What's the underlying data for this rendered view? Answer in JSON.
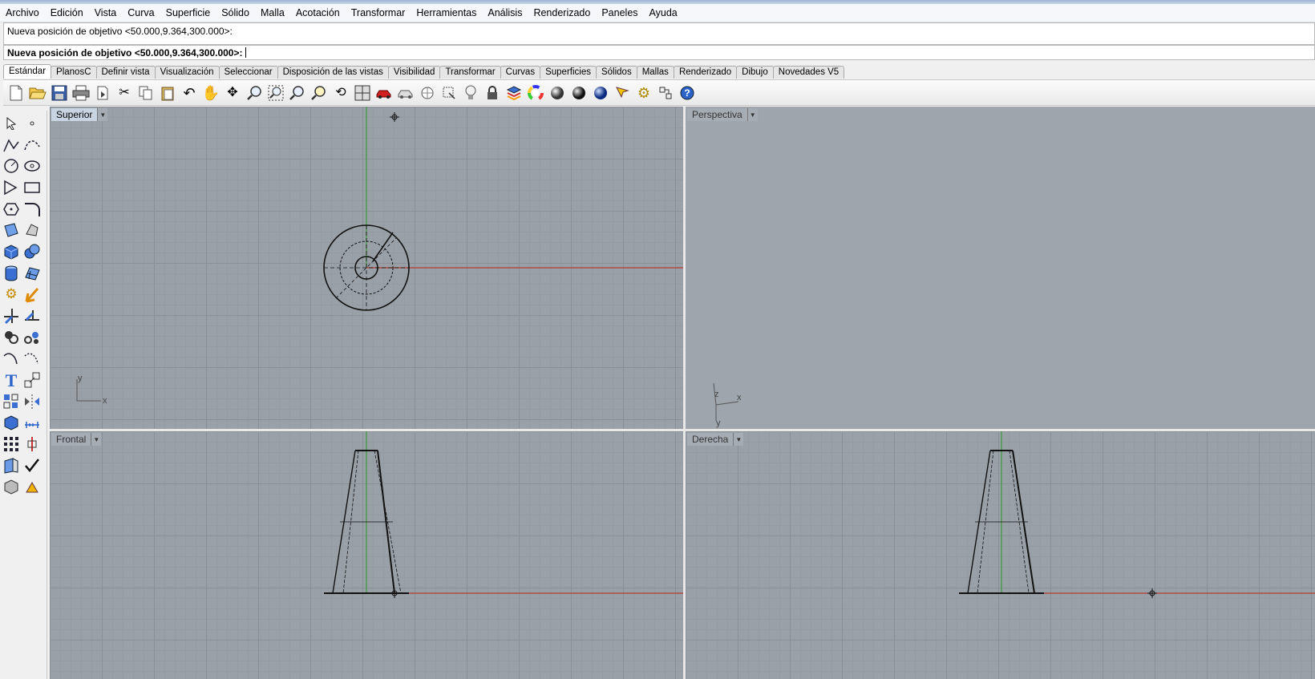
{
  "menu": [
    "Archivo",
    "Edición",
    "Vista",
    "Curva",
    "Superficie",
    "Sólido",
    "Malla",
    "Acotación",
    "Transformar",
    "Herramientas",
    "Análisis",
    "Renderizado",
    "Paneles",
    "Ayuda"
  ],
  "command": {
    "history": "Nueva posición de objetivo <50.000,9.364,300.000>:",
    "prompt": "Nueva posición de objetivo <50.000,9.364,300.000>:",
    "value": ""
  },
  "tabs": [
    "Estándar",
    "PlanosC",
    "Definir vista",
    "Visualización",
    "Seleccionar",
    "Disposición de las vistas",
    "Visibilidad",
    "Transformar",
    "Curvas",
    "Superficies",
    "Sólidos",
    "Mallas",
    "Renderizado",
    "Dibujo",
    "Novedades V5"
  ],
  "toolbar_icons": [
    "new-icon",
    "open-icon",
    "save-icon",
    "print-icon",
    "import-icon",
    "cut-icon",
    "copy-icon",
    "paste-icon",
    "undo-icon",
    "pan-icon",
    "rotate-view-icon",
    "zoom-icon",
    "zoom-window-icon",
    "zoom-extents-icon",
    "zoom-selected-icon",
    "rotate-icon",
    "viewport-layout-icon",
    "car-icon",
    "properties-icon",
    "snap-icon",
    "osnap-icon",
    "light-icon",
    "lock-icon",
    "layer-icon",
    "color-wheel-icon",
    "sphere-shaded-icon",
    "sphere-rendered-icon",
    "sphere-blue-icon",
    "select-icon",
    "settings-gear-icon",
    "history-icon",
    "help-icon"
  ],
  "viewports": {
    "top": {
      "label": "Superior",
      "axis_x": "x",
      "axis_y": "y"
    },
    "perspective": {
      "label": "Perspectiva",
      "axis_x": "x",
      "axis_y": "y",
      "axis_z": "z"
    },
    "front": {
      "label": "Frontal"
    },
    "right": {
      "label": "Derecha"
    }
  },
  "colors": {
    "x_axis": "#b33a2e",
    "y_axis": "#3a9a3a",
    "grid_bg": "#9aa0a8"
  }
}
